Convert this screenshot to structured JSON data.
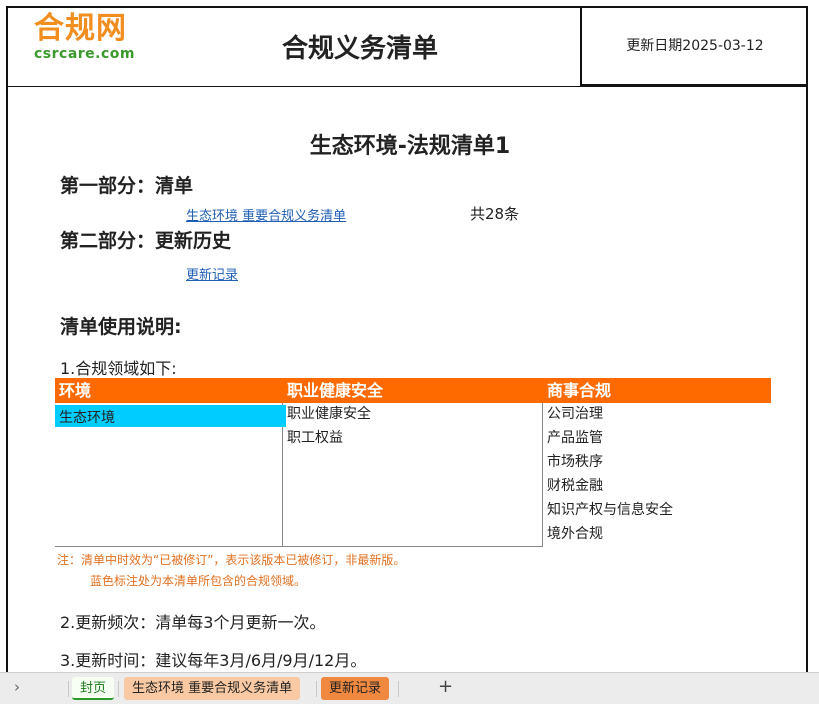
{
  "header": {
    "logo_main": "合规网",
    "logo_sub": "csrcare.com",
    "title": "合规义务清单",
    "update_date": "更新日期2025-03-12"
  },
  "sheet_title": "生态环境-法规清单1",
  "part1": {
    "heading": "第一部分：清单",
    "link": "生态环境 重要合规义务清单",
    "count": "共28条"
  },
  "part2": {
    "heading": "第二部分：更新历史",
    "link": "更新记录"
  },
  "usage": {
    "title": "清单使用说明:",
    "item1": "1.合规领域如下:",
    "item2": "2.更新频次：清单每3个月更新一次。",
    "item3": "3.更新时间：建议每年3月/6月/9月/12月。"
  },
  "domains": {
    "env_header": "环境",
    "env_items": [
      "生态环境"
    ],
    "ohs_header": "职业健康安全",
    "ohs_items": [
      "职业健康安全",
      "职工权益"
    ],
    "biz_header": "商事合规",
    "biz_items": [
      "公司治理",
      "产品监管",
      "市场秩序",
      "财税金融",
      "知识产权与信息安全",
      "境外合规"
    ]
  },
  "notes": {
    "line1": "注：清单中时效为“已被修订”，表示该版本已被修订，非最新版。",
    "line2": "蓝色标注处为本清单所包含的合规领域。"
  },
  "tabs": {
    "nav": "›",
    "cover": "封页",
    "list": "生态环境 重要合规义务清单",
    "history": "更新记录",
    "add": "+"
  },
  "colors": {
    "accent_orange": "#ff6a00",
    "highlight_blue": "#00ccff",
    "logo_orange": "#f28d1f",
    "logo_green": "#3a9a2c"
  }
}
